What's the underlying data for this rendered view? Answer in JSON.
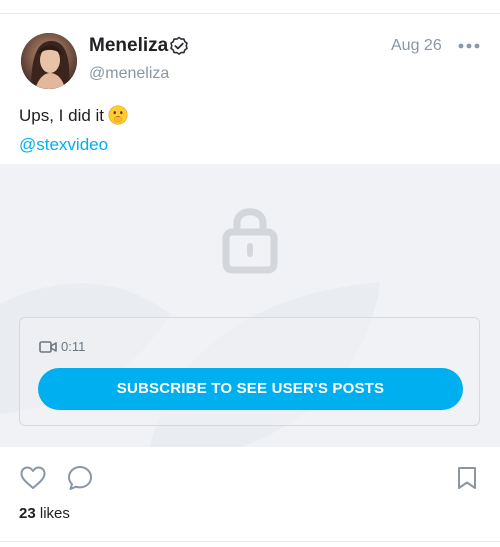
{
  "post": {
    "author": {
      "display_name": "Meneliza",
      "username": "@meneliza",
      "verified_icon": "verified-check-icon"
    },
    "date": "Aug 26",
    "more_icon": "more-horizontal-icon",
    "text": "Ups, I did it",
    "emoji": "shushing-face-emoji",
    "mention": "@stexvideo"
  },
  "media": {
    "lock_icon": "lock-icon",
    "video_icon": "video-camera-icon",
    "duration": "0:11",
    "subscribe_label": "SUBSCRIBE TO SEE USER'S POSTS"
  },
  "actions": {
    "like_icon": "heart-icon",
    "comment_icon": "comment-bubble-icon",
    "bookmark_icon": "bookmark-icon",
    "likes_number": "23",
    "likes_suffix": " likes"
  },
  "colors": {
    "accent": "#00aff0",
    "muted_text": "#8a96a3",
    "media_bg": "#f0f2f5"
  }
}
